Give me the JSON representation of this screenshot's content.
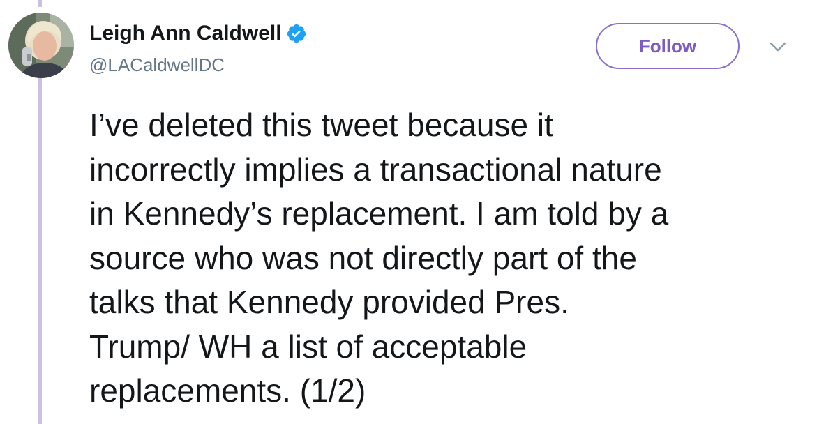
{
  "author": {
    "display_name": "Leigh Ann Caldwell",
    "handle": "@LACaldwellDC",
    "verified": true,
    "verified_icon": "verified-badge-icon",
    "avatar_icon": "profile-avatar"
  },
  "actions": {
    "follow_label": "Follow",
    "menu_icon": "chevron-down-icon"
  },
  "tweet": {
    "lines": [
      "I’ve deleted this tweet because it",
      "incorrectly implies a transactional nature",
      "in Kennedy’s replacement. I am told by a",
      "source who was not directly part of the",
      "talks that Kennedy provided Pres.",
      "Trump/ WH a list of acceptable",
      "replacements. (1/2)"
    ]
  },
  "colors": {
    "text": "#14171a",
    "handle": "#657786",
    "accent": "#7c5cc4",
    "verified": "#1da1f2",
    "thread_line": "#c9c0e4"
  }
}
